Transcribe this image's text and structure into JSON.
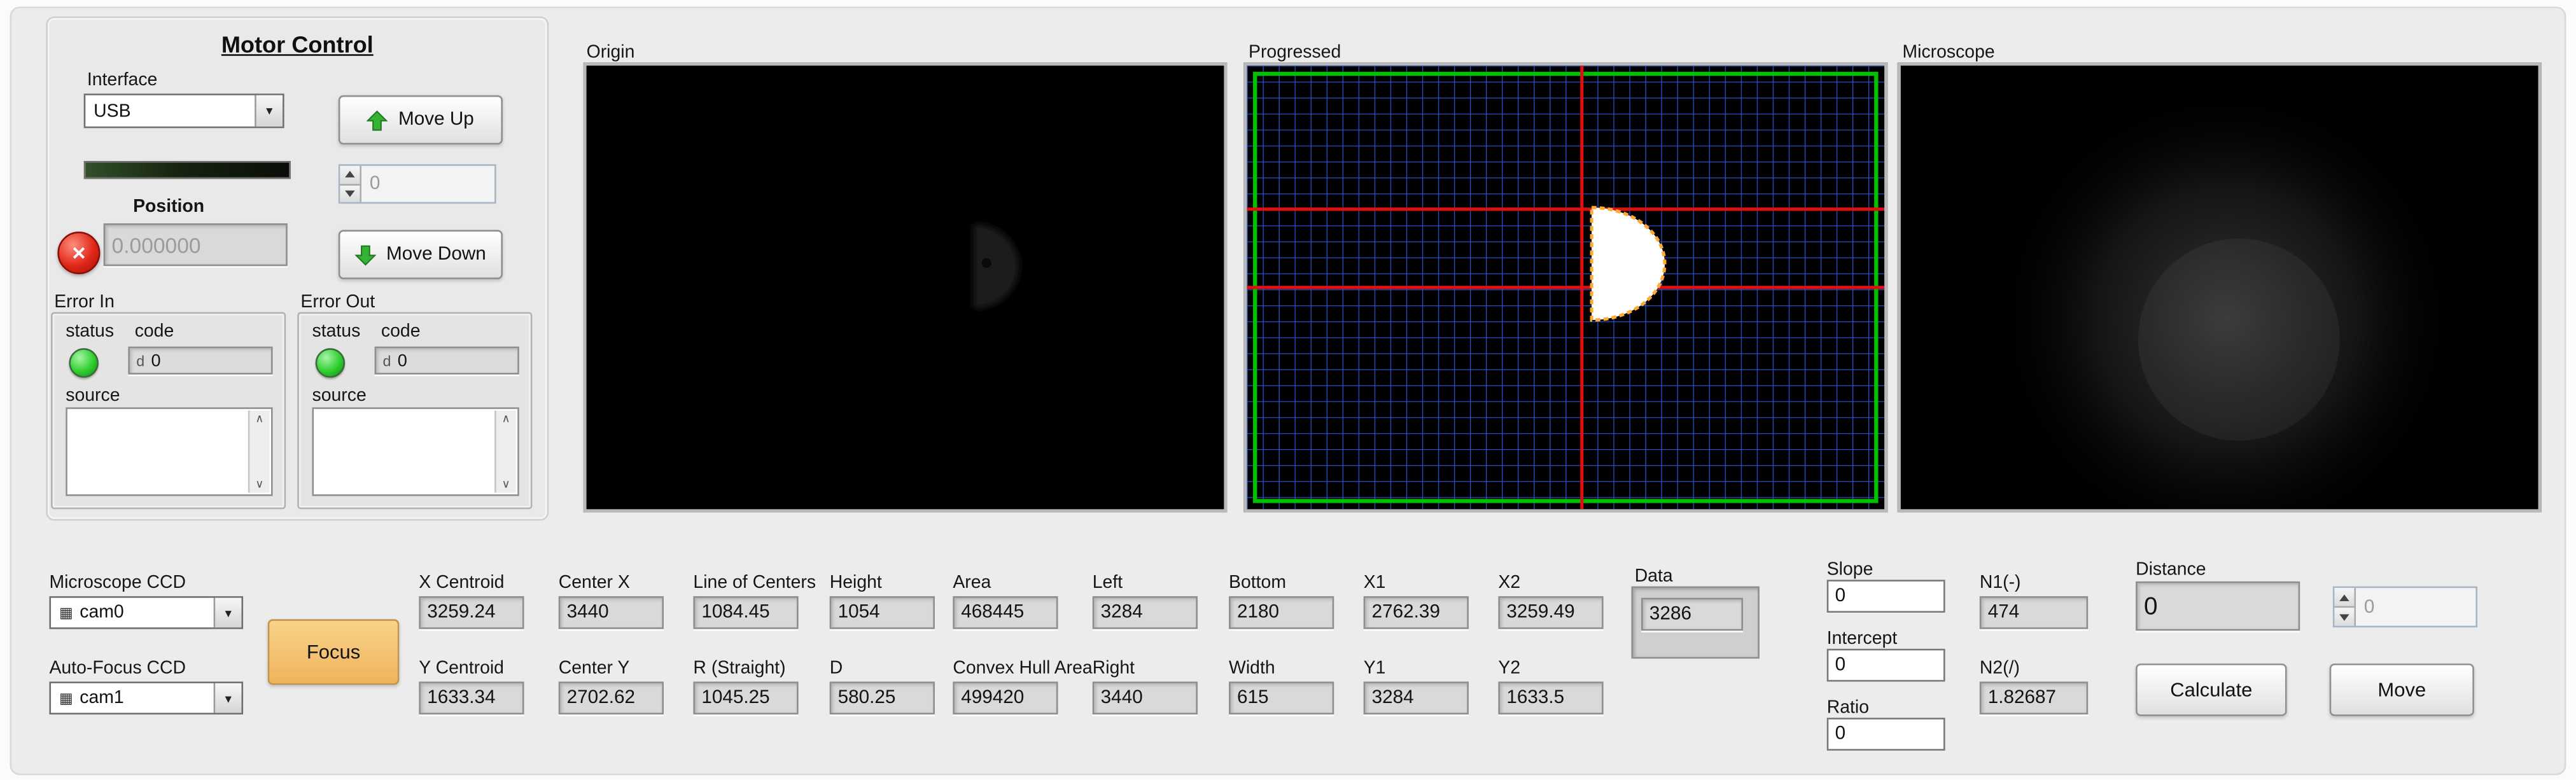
{
  "motor_control": {
    "title": "Motor Control",
    "interface_label": "Interface",
    "interface_value": "USB",
    "position_label": "Position",
    "position_value": "0.000000",
    "move_up_label": "Move Up",
    "move_down_label": "Move Down",
    "step_value": "0",
    "error_in": {
      "label": "Error In",
      "status_label": "status",
      "code_label": "code",
      "code_radix": "d",
      "code_value": "0",
      "source_label": "source",
      "source_value": ""
    },
    "error_out": {
      "label": "Error Out",
      "status_label": "status",
      "code_label": "code",
      "code_radix": "d",
      "code_value": "0",
      "source_label": "source",
      "source_value": ""
    }
  },
  "displays": {
    "origin_label": "Origin",
    "progressed_label": "Progressed",
    "microscope_label": "Microscope"
  },
  "cameras": {
    "microscope_ccd_label": "Microscope CCD",
    "microscope_ccd_value": "cam0",
    "autofocus_ccd_label": "Auto-Focus CCD",
    "autofocus_ccd_value": "cam1",
    "focus_button_label": "Focus"
  },
  "measurements": {
    "row1": [
      {
        "label": "X Centroid",
        "value": "3259.24"
      },
      {
        "label": "Center X",
        "value": "3440"
      },
      {
        "label": "Line of Centers",
        "value": "1084.45"
      },
      {
        "label": "Height",
        "value": "1054"
      },
      {
        "label": "Area",
        "value": "468445"
      },
      {
        "label": "Left",
        "value": "3284"
      },
      {
        "label": "Bottom",
        "value": "2180"
      },
      {
        "label": "X1",
        "value": "2762.39"
      },
      {
        "label": "X2",
        "value": "3259.49"
      }
    ],
    "row2": [
      {
        "label": "Y Centroid",
        "value": "1633.34"
      },
      {
        "label": "Center Y",
        "value": "2702.62"
      },
      {
        "label": "R (Straight)",
        "value": "1045.25"
      },
      {
        "label": "D",
        "value": "580.25"
      },
      {
        "label": "Convex Hull Area",
        "value": "499420"
      },
      {
        "label": "Right",
        "value": "3440"
      },
      {
        "label": "Width",
        "value": "615"
      },
      {
        "label": "Y1",
        "value": "3284"
      },
      {
        "label": "Y2",
        "value": "1633.5"
      }
    ],
    "data_label": "Data",
    "data_value": "3286"
  },
  "calc": {
    "slope_label": "Slope",
    "slope_value": "0",
    "intercept_label": "Intercept",
    "intercept_value": "0",
    "ratio_label": "Ratio",
    "ratio_value": "0",
    "n1_label": "N1(-)",
    "n1_value": "474",
    "n2_label": "N2(/)",
    "n2_value": "1.82687",
    "distance_label": "Distance",
    "distance_value": "0",
    "target_value": "0",
    "calculate_label": "Calculate",
    "move_label": "Move"
  },
  "icons": {
    "dropdown": "▾",
    "close": "✕",
    "scroll_up": "∧",
    "scroll_down": "∨",
    "camera": "▦"
  },
  "colors": {
    "panel": "#ececec",
    "led_green": "#2fcf2f",
    "stop_red": "#d62718",
    "focus_button": "#f3c06a",
    "grid_blue": "#2a52cc",
    "crosshair_red": "#e01010",
    "roi_green": "#00c000",
    "blob_outline": "#ffaa33"
  }
}
